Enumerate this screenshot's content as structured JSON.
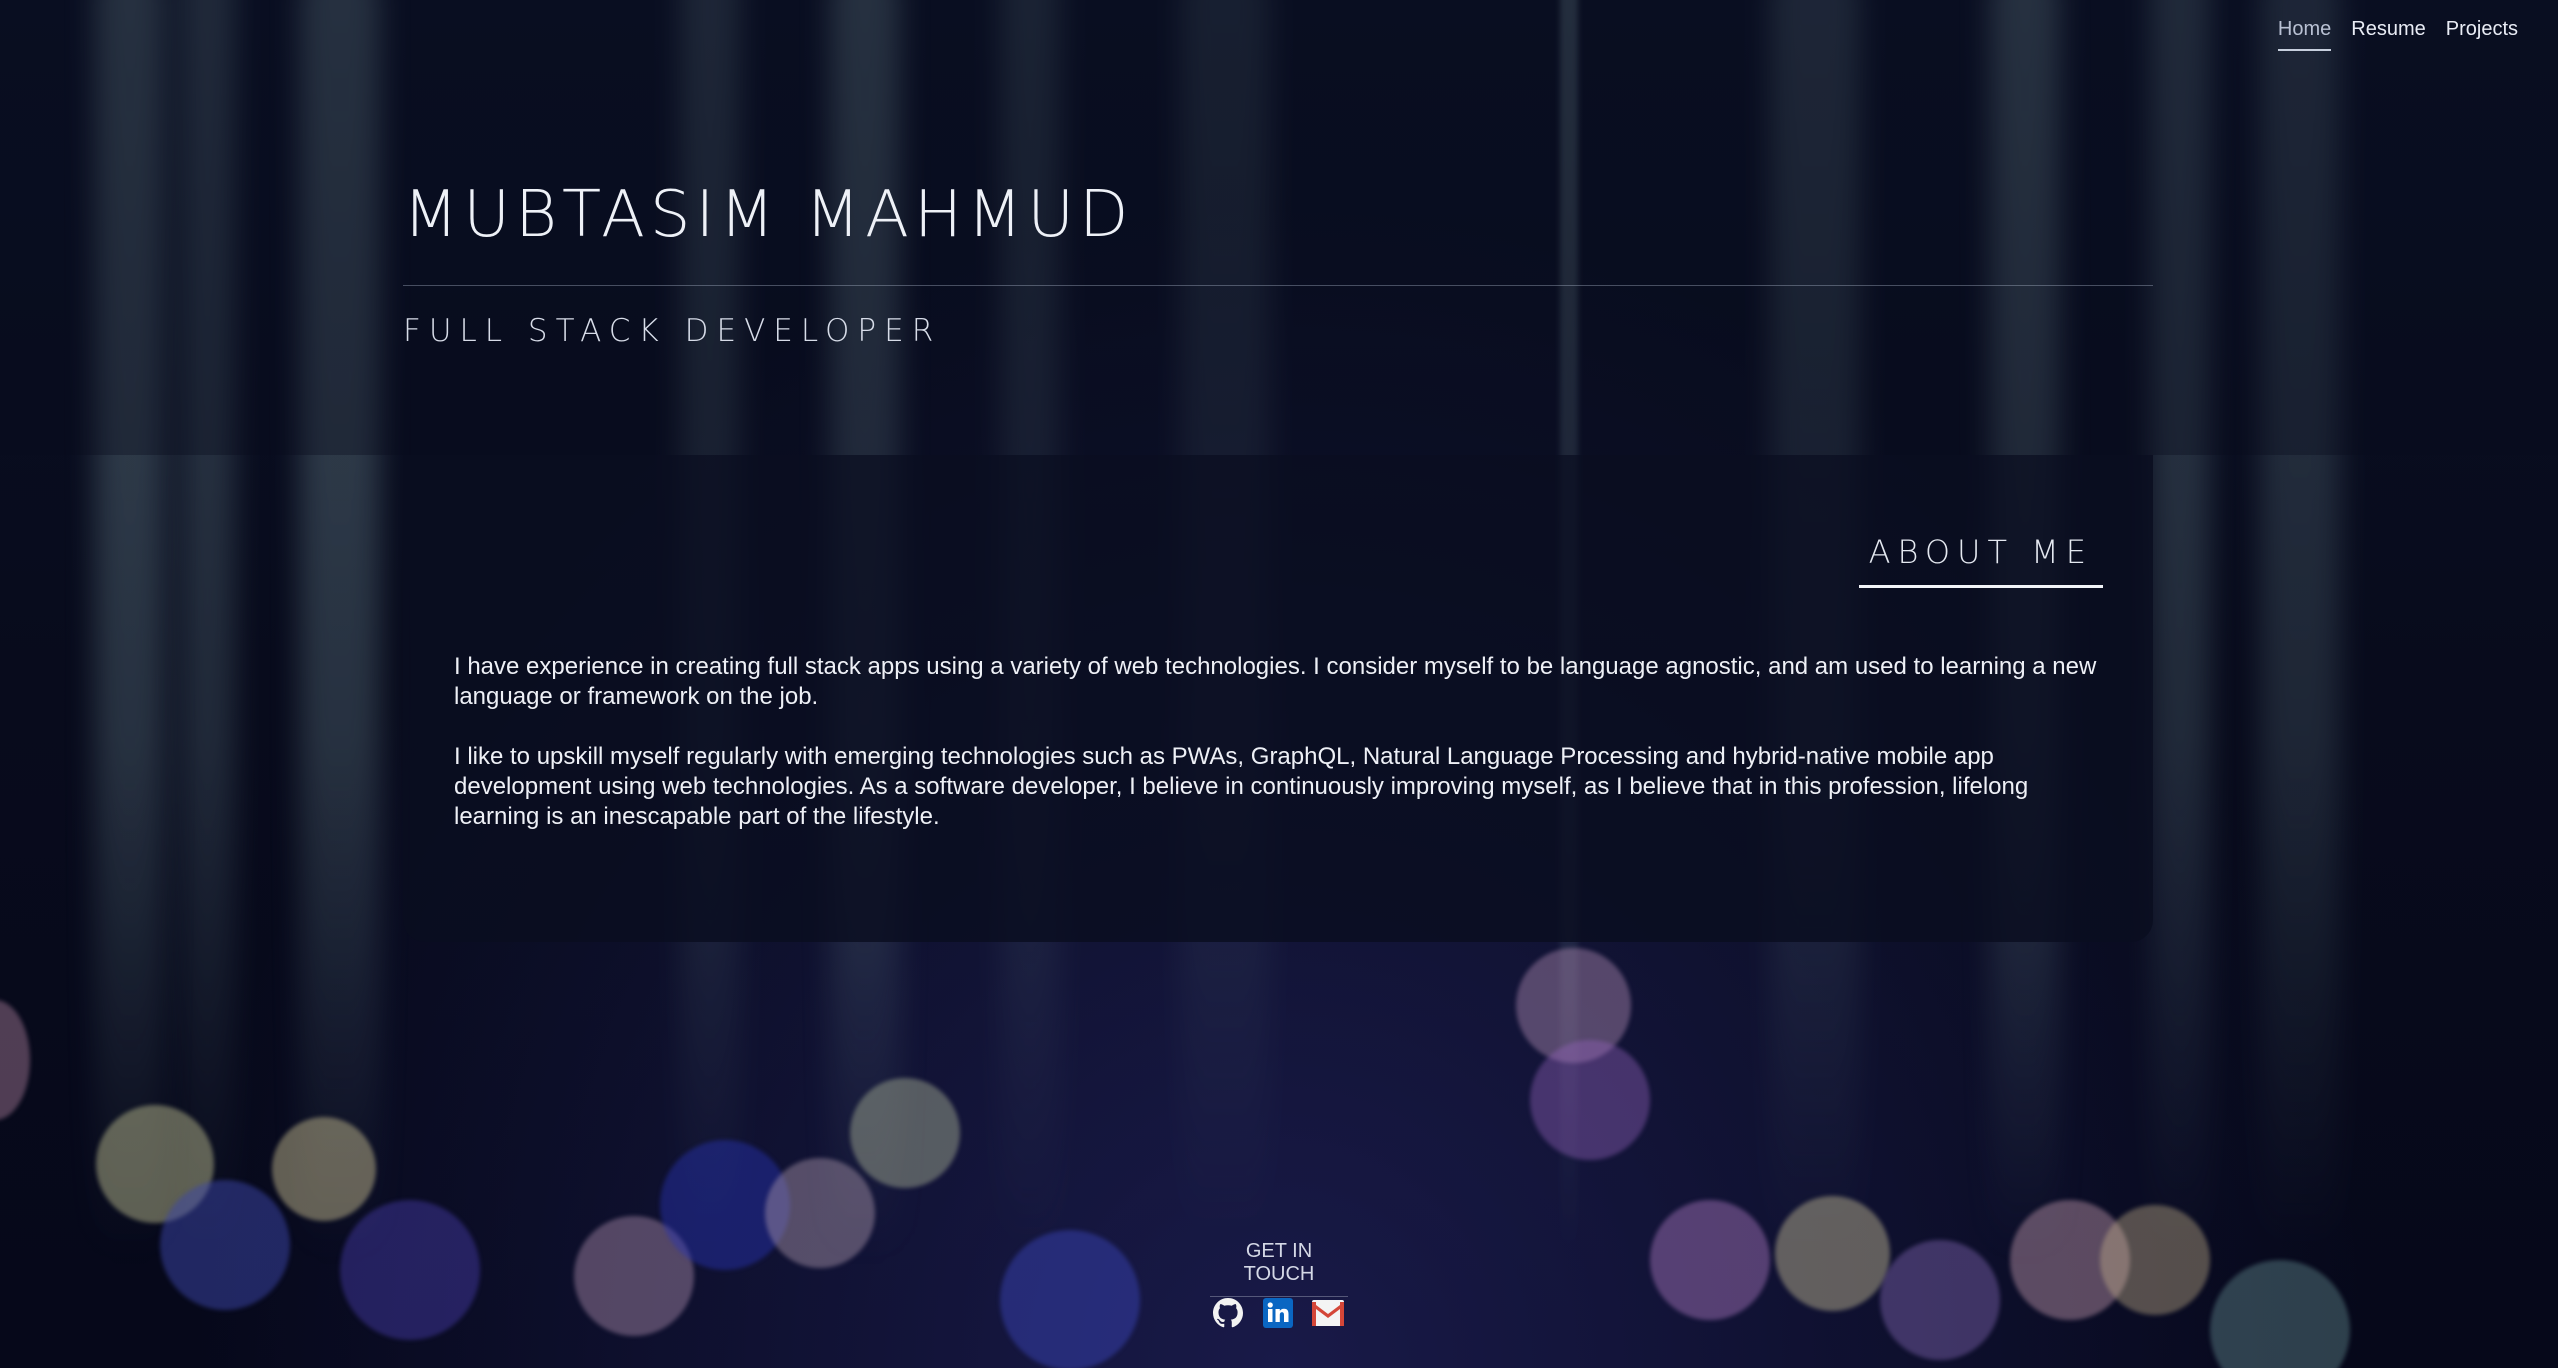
{
  "nav": {
    "items": [
      {
        "label": "Home",
        "active": true
      },
      {
        "label": "Resume",
        "active": false
      },
      {
        "label": "Projects",
        "active": false
      }
    ]
  },
  "hero": {
    "name": "MUBTASIM MAHMUD",
    "role": "FULL STACK DEVELOPER"
  },
  "about": {
    "title": "ABOUT ME",
    "paragraphs": [
      "I have experience in creating full stack apps using a variety of web technologies. I consider myself to be language agnostic, and am used to learning a new language or framework on the job.",
      "I like to upskill myself regularly with emerging technologies such as PWAs, GraphQL, Natural Language Processing and hybrid-native mobile app development using web technologies. As a software developer, I believe in continuously improving myself, as I believe that in this profession, lifelong learning is an inescapable part of the lifestyle."
    ]
  },
  "footer": {
    "heading": "GET IN TOUCH",
    "socials": [
      {
        "icon": "github-icon"
      },
      {
        "icon": "linkedin-icon"
      },
      {
        "icon": "gmail-icon"
      }
    ]
  },
  "colors": {
    "background": "#070a18",
    "text": "#e8ebf2",
    "card": "#0a0d20",
    "linkedin": "#0a66c2",
    "gmail_red": "#d44638"
  }
}
